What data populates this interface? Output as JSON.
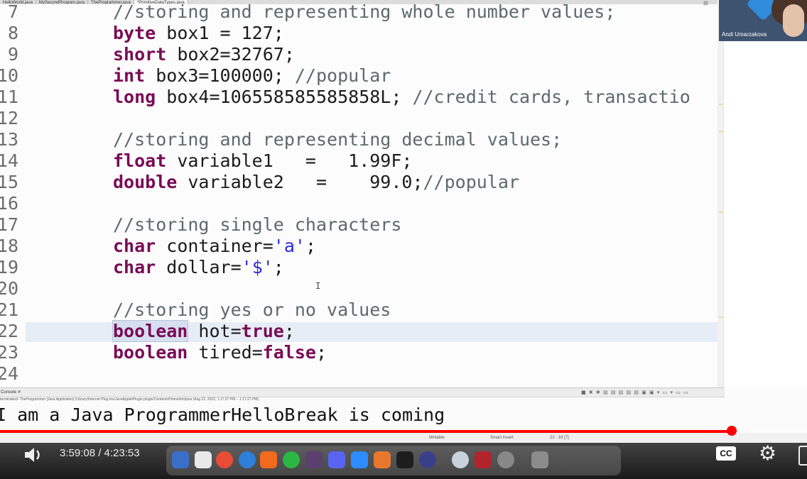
{
  "tabs": [
    "HelloWorld.java",
    "MySecondProgram.java",
    "TheProgrammer.java",
    "*PrimitiveDataTypes.java"
  ],
  "editor": {
    "lines": [
      {
        "num": "7",
        "parts": [
          [
            "cm",
            "//storing and representing whole number values;"
          ]
        ]
      },
      {
        "num": "8",
        "parts": [
          [
            "kw",
            "byte"
          ],
          [
            "",
            " box1 = 127;"
          ]
        ]
      },
      {
        "num": "9",
        "parts": [
          [
            "kw",
            "short"
          ],
          [
            "",
            " box2=32767;"
          ]
        ]
      },
      {
        "num": "10",
        "parts": [
          [
            "kw",
            "int"
          ],
          [
            "",
            " box3=100000; "
          ],
          [
            "cm",
            "//popular"
          ]
        ]
      },
      {
        "num": "11",
        "parts": [
          [
            "kw",
            "long"
          ],
          [
            "",
            " box4=106558585585858L; "
          ],
          [
            "cm",
            "//credit cards, transactio"
          ]
        ]
      },
      {
        "num": "12",
        "parts": []
      },
      {
        "num": "13",
        "parts": [
          [
            "cm",
            "//storing and representing decimal values;"
          ]
        ]
      },
      {
        "num": "14",
        "parts": [
          [
            "kw",
            "float"
          ],
          [
            "",
            " variable1   =   1.99F;"
          ]
        ]
      },
      {
        "num": "15",
        "parts": [
          [
            "kw",
            "double"
          ],
          [
            "",
            " variable2   =    99.0;"
          ],
          [
            "cm",
            "//popular"
          ]
        ]
      },
      {
        "num": "16",
        "parts": []
      },
      {
        "num": "17",
        "parts": [
          [
            "cm",
            "//storing single characters"
          ]
        ]
      },
      {
        "num": "18",
        "parts": [
          [
            "kw",
            "char"
          ],
          [
            "",
            " container="
          ],
          [
            "st",
            "'a'"
          ],
          [
            "",
            ";"
          ]
        ]
      },
      {
        "num": "19",
        "parts": [
          [
            "kw",
            "char"
          ],
          [
            "",
            " dollar="
          ],
          [
            "st",
            "'$'"
          ],
          [
            "",
            ";"
          ]
        ]
      },
      {
        "num": "20",
        "parts": []
      },
      {
        "num": "21",
        "parts": [
          [
            "cm",
            "//storing yes or no values"
          ]
        ]
      },
      {
        "num": "22",
        "parts": [
          [
            "kw kwbox",
            "boolean"
          ],
          [
            "",
            " hot="
          ],
          [
            "kw",
            "true"
          ],
          [
            "",
            ";"
          ]
        ]
      },
      {
        "num": "23",
        "parts": [
          [
            "kw",
            "boolean"
          ],
          [
            "",
            " tired="
          ],
          [
            "kw",
            "false"
          ],
          [
            "",
            ";"
          ]
        ]
      },
      {
        "num": "24",
        "parts": []
      }
    ]
  },
  "console": {
    "tab_label": "Console ✕",
    "path": "terminated> TheProgrammer [Java Application] /Library/Internet Plug-Ins/JavaAppletPlugin.plugin/Contents/Home/bin/java (Aug 22, 2022, 1:17:27 PM – 1:17:27 PM)",
    "output": "I am a Java ProgrammerHelloBreak is coming"
  },
  "statusbar": {
    "writable": "Writable",
    "insert": "Smart Insert",
    "position": "22 : 16 [7]"
  },
  "webcam": {
    "name": "Andi Umarzakova"
  },
  "player": {
    "time_label": "3:59:08 / 4:23:53",
    "progress": 0.9066,
    "cc_label": "CC"
  },
  "colors": {
    "accent": "#ff0000",
    "keyword": "#7a0b55",
    "comment": "#5d6a6a",
    "string": "#2a2ad8"
  },
  "icons": [
    "volume-icon",
    "settings-gear-icon",
    "theater-mode-icon",
    "finder-icon",
    "calendar-icon",
    "chrome-icon",
    "safari-icon",
    "firefox-icon",
    "whatsapp-icon",
    "slack-icon",
    "discord-icon",
    "zoom-icon",
    "sublime-icon",
    "terminal-icon",
    "vpn-icon",
    "eclipse-icon",
    "acrobat-icon",
    "preview-icon",
    "trash-icon"
  ]
}
